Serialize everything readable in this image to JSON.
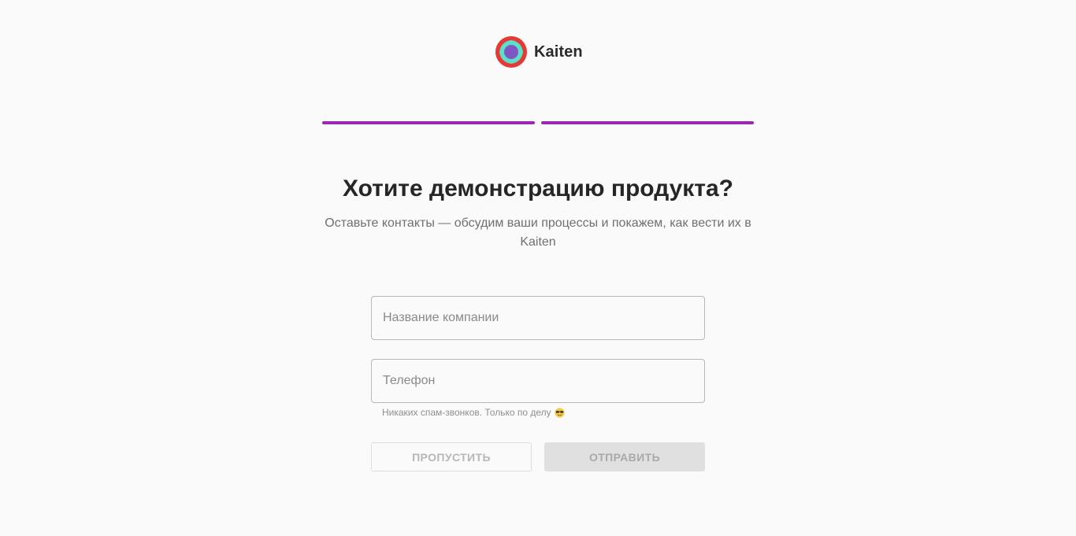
{
  "brand": {
    "name": "Kaiten",
    "logo_colors": {
      "outer": "#e53935",
      "middle": "#5ce0c8",
      "inner": "#7e57c2"
    }
  },
  "progress": {
    "steps_total": 2,
    "steps_completed": 2,
    "accent_color": "#9c27b0"
  },
  "heading": {
    "title": "Хотите демонстрацию продукта?",
    "subtitle": "Оставьте контакты — обсудим ваши процессы и покажем, как вести их в Kaiten"
  },
  "form": {
    "company": {
      "placeholder": "Название компании",
      "value": ""
    },
    "phone": {
      "placeholder": "Телефон",
      "value": "",
      "hint": "Никаких спам-звонков. Только по делу",
      "hint_icon": "sunglasses-emoji-icon"
    }
  },
  "buttons": {
    "skip_label": "ПРОПУСТИТЬ",
    "submit_label": "ОТПРАВИТЬ"
  }
}
